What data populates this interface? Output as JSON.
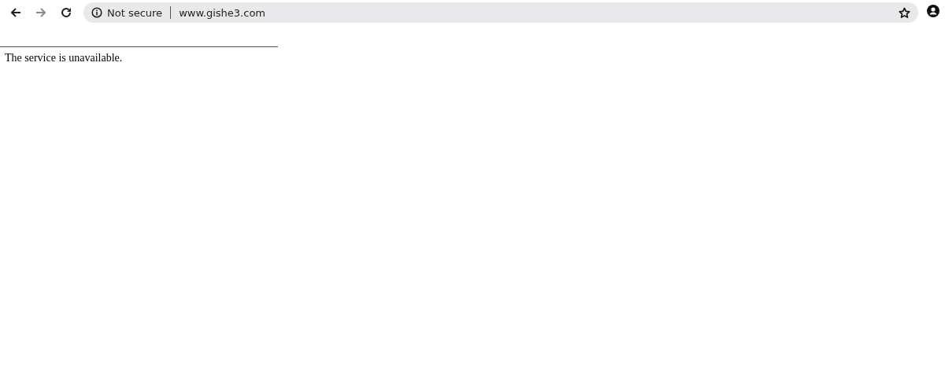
{
  "toolbar": {
    "nav_buttons": [
      {
        "kind": "back",
        "disabled": false
      },
      {
        "kind": "forward",
        "disabled": true
      },
      {
        "kind": "reload",
        "disabled": false
      }
    ],
    "address_bar": {
      "security_label": "Not secure",
      "url": "www.gishe3.com"
    }
  },
  "page": {
    "message": "The service is unavailable."
  }
}
